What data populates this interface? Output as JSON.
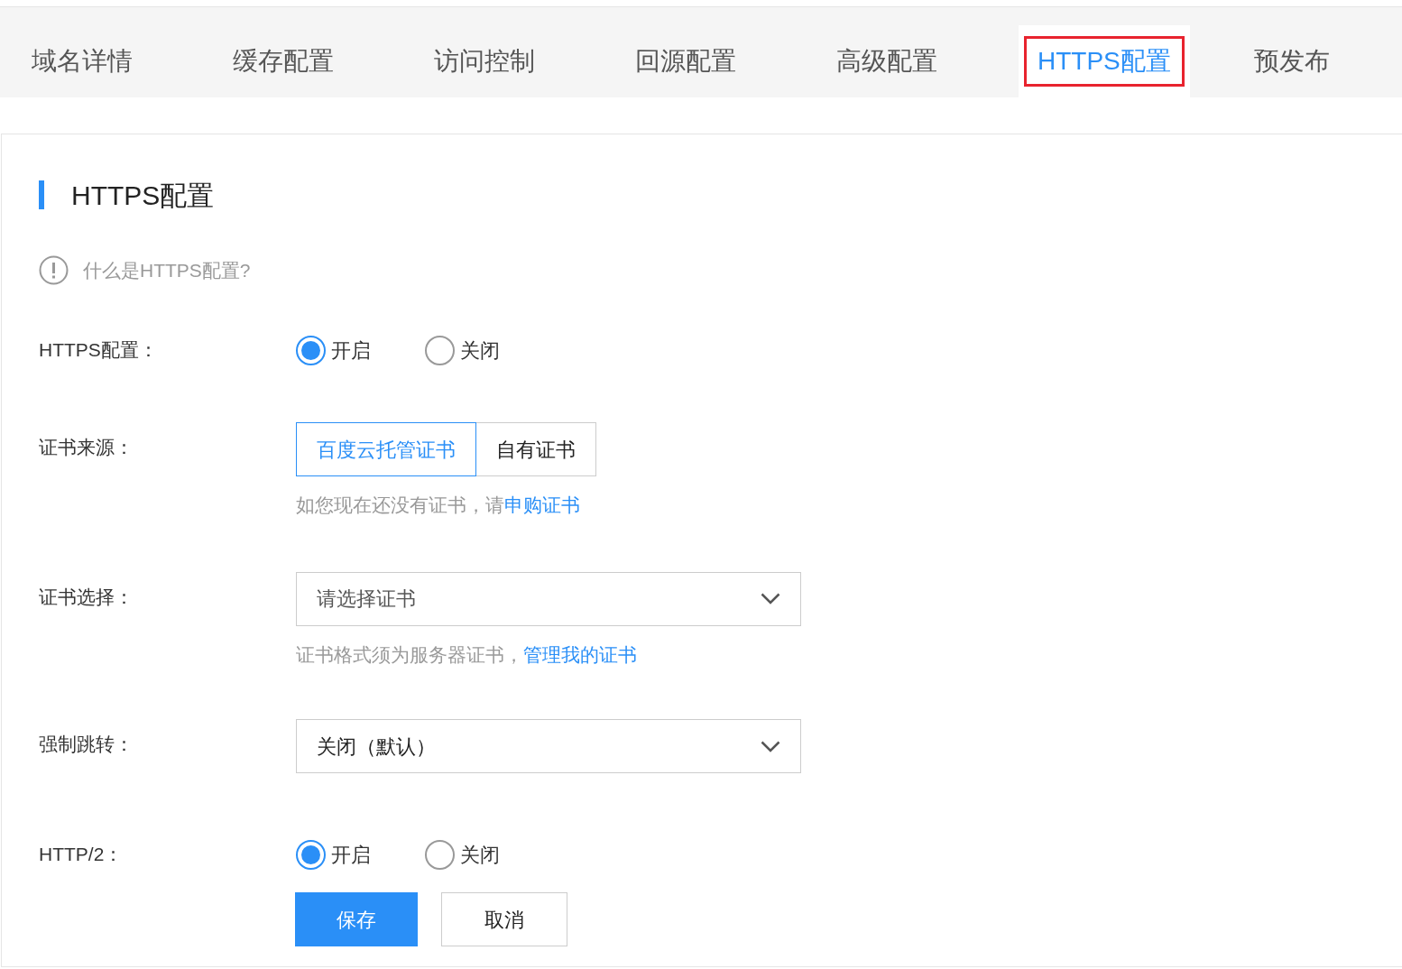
{
  "tabs": [
    {
      "label": "域名详情",
      "selected": false,
      "highlighted": false
    },
    {
      "label": "缓存配置",
      "selected": false,
      "highlighted": false
    },
    {
      "label": "访问控制",
      "selected": false,
      "highlighted": false
    },
    {
      "label": "回源配置",
      "selected": false,
      "highlighted": false
    },
    {
      "label": "高级配置",
      "selected": false,
      "highlighted": false
    },
    {
      "label": "HTTPS配置",
      "selected": true,
      "highlighted": true
    },
    {
      "label": "预发布",
      "selected": false,
      "highlighted": false
    }
  ],
  "section": {
    "title": "HTTPS配置",
    "help": "什么是HTTPS配置?"
  },
  "fields": [
    {
      "kind": "radio",
      "label": "HTTPS配置：",
      "options": [
        {
          "label": "开启",
          "selected": true
        },
        {
          "label": "关闭",
          "selected": false
        }
      ]
    },
    {
      "kind": "segmented",
      "label": "证书来源：",
      "options": [
        {
          "label": "百度云托管证书",
          "selected": true
        },
        {
          "label": "自有证书",
          "selected": false
        }
      ],
      "hint": "如您现在还没有证书，请",
      "link": "申购证书"
    },
    {
      "kind": "select",
      "label": "证书选择：",
      "placeholder": "请选择证书",
      "hint": "证书格式须为服务器证书，",
      "link": "管理我的证书"
    },
    {
      "kind": "select",
      "label": "强制跳转：",
      "value": "关闭（默认）"
    },
    {
      "kind": "radio",
      "label": "HTTP/2：",
      "options": [
        {
          "label": "开启",
          "selected": true
        },
        {
          "label": "关闭",
          "selected": false
        }
      ]
    }
  ],
  "buttons": [
    {
      "label": "保存",
      "kind": "primary"
    },
    {
      "label": "取消",
      "kind": "secondary"
    }
  ]
}
